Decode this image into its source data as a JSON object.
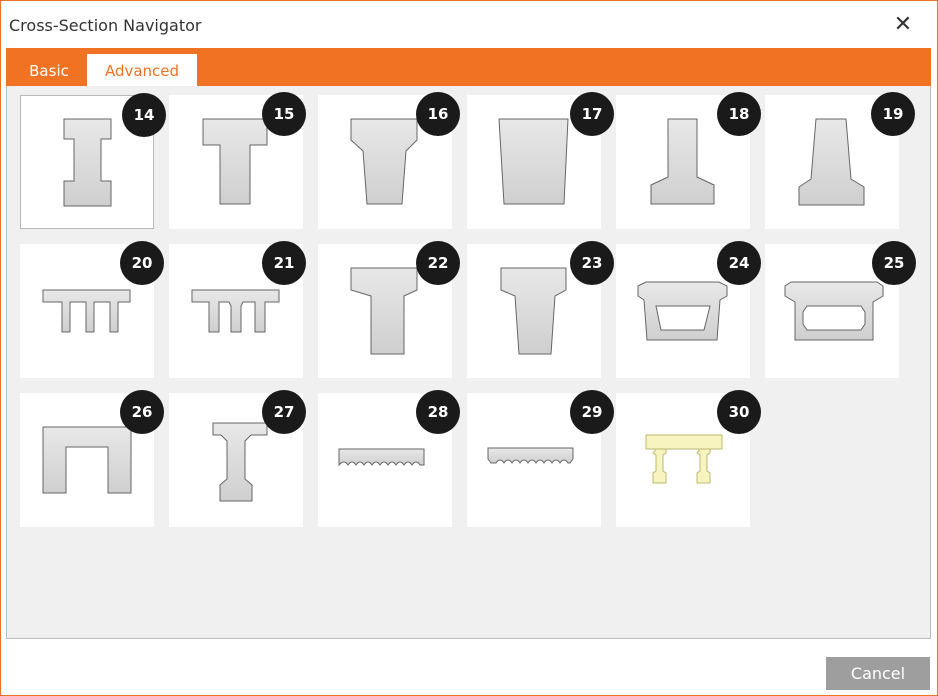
{
  "window": {
    "title": "Cross-Section Navigator"
  },
  "tabs": [
    {
      "label": "Basic",
      "selected": false
    },
    {
      "label": "Advanced",
      "selected": true
    }
  ],
  "sections": [
    {
      "number": "14",
      "icon": "i-beam-section-icon",
      "selected": true
    },
    {
      "number": "15",
      "icon": "t-beam-section-icon"
    },
    {
      "number": "16",
      "icon": "tapered-t-section-icon"
    },
    {
      "number": "17",
      "icon": "trapezoid-section-icon"
    },
    {
      "number": "18",
      "icon": "inverted-t-section-icon"
    },
    {
      "number": "19",
      "icon": "tapered-inverted-t-section-icon"
    },
    {
      "number": "20",
      "icon": "double-t-section-icon"
    },
    {
      "number": "21",
      "icon": "double-t-haunched-section-icon"
    },
    {
      "number": "22",
      "icon": "bulb-t-section-icon"
    },
    {
      "number": "23",
      "icon": "tapered-bulb-t-section-icon"
    },
    {
      "number": "24",
      "icon": "box-girder-trapezoid-section-icon"
    },
    {
      "number": "25",
      "icon": "box-girder-section-icon"
    },
    {
      "number": "26",
      "icon": "u-section-icon"
    },
    {
      "number": "27",
      "icon": "bulb-i-section-icon"
    },
    {
      "number": "28",
      "icon": "voided-slab-section-icon"
    },
    {
      "number": "29",
      "icon": "voided-slab-chamfer-section-icon"
    },
    {
      "number": "30",
      "icon": "composite-girder-section-icon"
    }
  ],
  "footer": {
    "cancel_label": "Cancel"
  },
  "colors": {
    "accent": "#f07222",
    "badge": "#1a1a1a",
    "cancel": "#9e9e9e"
  }
}
